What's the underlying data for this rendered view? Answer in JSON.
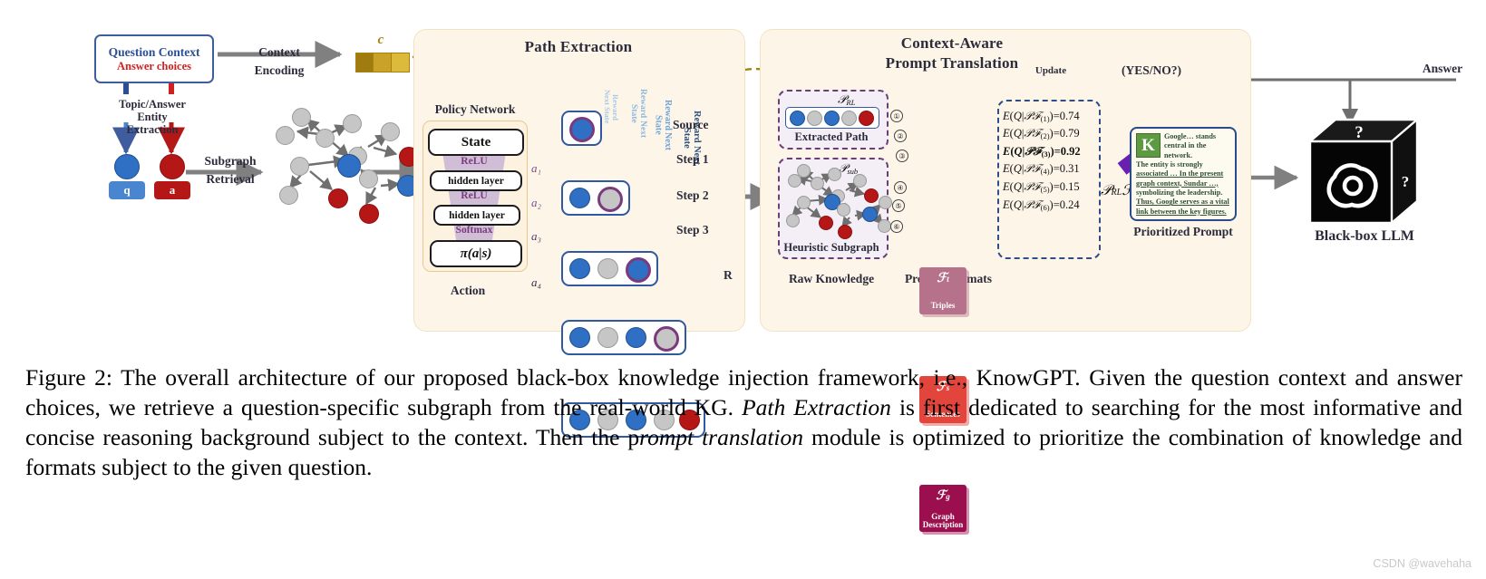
{
  "figure": {
    "number": "Figure 2:",
    "caption_part1": " The overall architecture of our proposed black-box knowledge injection framework, i.e., KnowGPT. Given the question context and answer choices, we retrieve a question-specific subgraph from the real-world KG. ",
    "caption_italic1": "Path Extraction",
    "caption_part2": " is first dedicated to searching for the most informative and concise reasoning background subject to the context. Then the p",
    "caption_italic2": "rompt translation",
    "caption_part3": " module is optimized to prioritize the combination of knowledge and formats subject to the given question."
  },
  "watermark": "CSDN @wavehaha",
  "input": {
    "question_context": "Question Context",
    "answer_choices": "Answer choices",
    "entity_extraction": "Topic/Answer\nEntity\nExtraction",
    "entity_extraction_l1": "Topic/Answer",
    "entity_extraction_l2": "Entity",
    "entity_extraction_l3": "Extraction",
    "token_q": "q",
    "token_a": "a",
    "context_encoding_l1": "Context",
    "context_encoding_l2": "Encoding",
    "embedding_symbol": "c",
    "subgraph_retrieval_l1": "Subgraph",
    "subgraph_retrieval_l2": "Retrieval"
  },
  "path_extraction": {
    "title": "Path Extraction",
    "policy_network": "Policy Network",
    "state": "State",
    "relu1": "ReLU",
    "hidden1": "hidden layer",
    "relu2": "ReLU",
    "hidden2": "hidden layer",
    "softmax": "Softmax",
    "policy": "π(a|s)",
    "action": "Action",
    "actions": [
      "a₁",
      "a₂",
      "a₃",
      "a₄"
    ],
    "steps": [
      "Source",
      "Step 1",
      "Step 2",
      "Step 3"
    ],
    "reward_label": "Reward",
    "next_state_label": "Next State",
    "reward_out": "R"
  },
  "prompt_translation": {
    "title_l1": "Context-Aware",
    "title_l2": "Prompt Translation",
    "p_rl": "𝒫",
    "p_rl_sub": "RL",
    "extracted_path": "Extracted Path",
    "p_sub_sub": "sub",
    "heuristic_subgraph": "Heuristic Subgraph",
    "raw_knowledge": "Raw Knowledge",
    "prompt_formats": "Prompt Formats",
    "format_cards": [
      {
        "symbol": "ℱ",
        "sub": "t",
        "name": "Triples",
        "color": "#b5728a"
      },
      {
        "symbol": "ℱ",
        "sub": "s",
        "name": "Sentences",
        "color": "#e2453c"
      },
      {
        "symbol": "ℱ",
        "sub": "g",
        "name_l1": "Graph",
        "name_l2": "Description",
        "name": "Graph Description",
        "color": "#9c0f4e"
      }
    ],
    "connector_numbers": [
      "①",
      "②",
      "③",
      "④",
      "⑤",
      "⑥"
    ],
    "update_label": "Update",
    "equations": [
      {
        "index": "(1)",
        "value": "0.74",
        "bold": false
      },
      {
        "index": "(2)",
        "value": "0.79",
        "bold": false
      },
      {
        "index": "(3)",
        "value": "0.92",
        "bold": true
      },
      {
        "index": "(4)",
        "value": "0.31",
        "bold": false
      },
      {
        "index": "(5)",
        "value": "0.15",
        "bold": false
      },
      {
        "index": "(6)",
        "value": "0.24",
        "bold": false
      }
    ],
    "selected_combo_main": "𝒫",
    "selected_combo_sub1": "RL",
    "selected_combo_main2": "ℱ",
    "selected_combo_sub2": "g",
    "prompt_card": {
      "k_icon": "K",
      "lines": [
        "Google… stands",
        "central in the network.",
        "The entity is strongly",
        "associated … In the present",
        "graph context, Sundar …,",
        "symbolizing the leadership.",
        "Thus, Google serves as a vital",
        "link between the key figures."
      ]
    },
    "prioritized_prompt": "Prioritized Prompt"
  },
  "llm": {
    "answer_label": "Answer",
    "yesno_label": "(YES/NO?)",
    "name": "Black-box LLM",
    "question_mark": "?"
  },
  "colors": {
    "panel_bg": "#fdf6e8",
    "node_blue": "#2f6fc4",
    "node_red": "#b51717",
    "node_grey": "#c6c6c6",
    "purple": "#7b3a7e",
    "gold": "#c9a227",
    "arrow_grey": "#808080",
    "step_blue": "#3059a0"
  }
}
